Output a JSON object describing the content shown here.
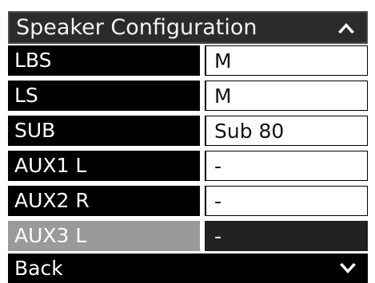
{
  "header": {
    "title": "Speaker Configuration",
    "scroll_up_icon": "chevron-up-icon"
  },
  "rows": [
    {
      "label": "LBS",
      "value": "M",
      "selected": false
    },
    {
      "label": "LS",
      "value": "M",
      "selected": false
    },
    {
      "label": "SUB",
      "value": "Sub 80",
      "selected": false
    },
    {
      "label": "AUX1 L",
      "value": "-",
      "selected": false
    },
    {
      "label": "AUX2 R",
      "value": "-",
      "selected": false
    },
    {
      "label": "AUX3 L",
      "value": "-",
      "selected": true
    }
  ],
  "footer": {
    "back_label": "Back",
    "scroll_down_icon": "chevron-down-icon"
  },
  "colors": {
    "header_bg": "#2b2b2b",
    "row_label_bg": "#000000",
    "row_value_bg": "#ffffff",
    "selected_label_bg": "#9a9a9a",
    "selected_value_bg": "#222222"
  }
}
